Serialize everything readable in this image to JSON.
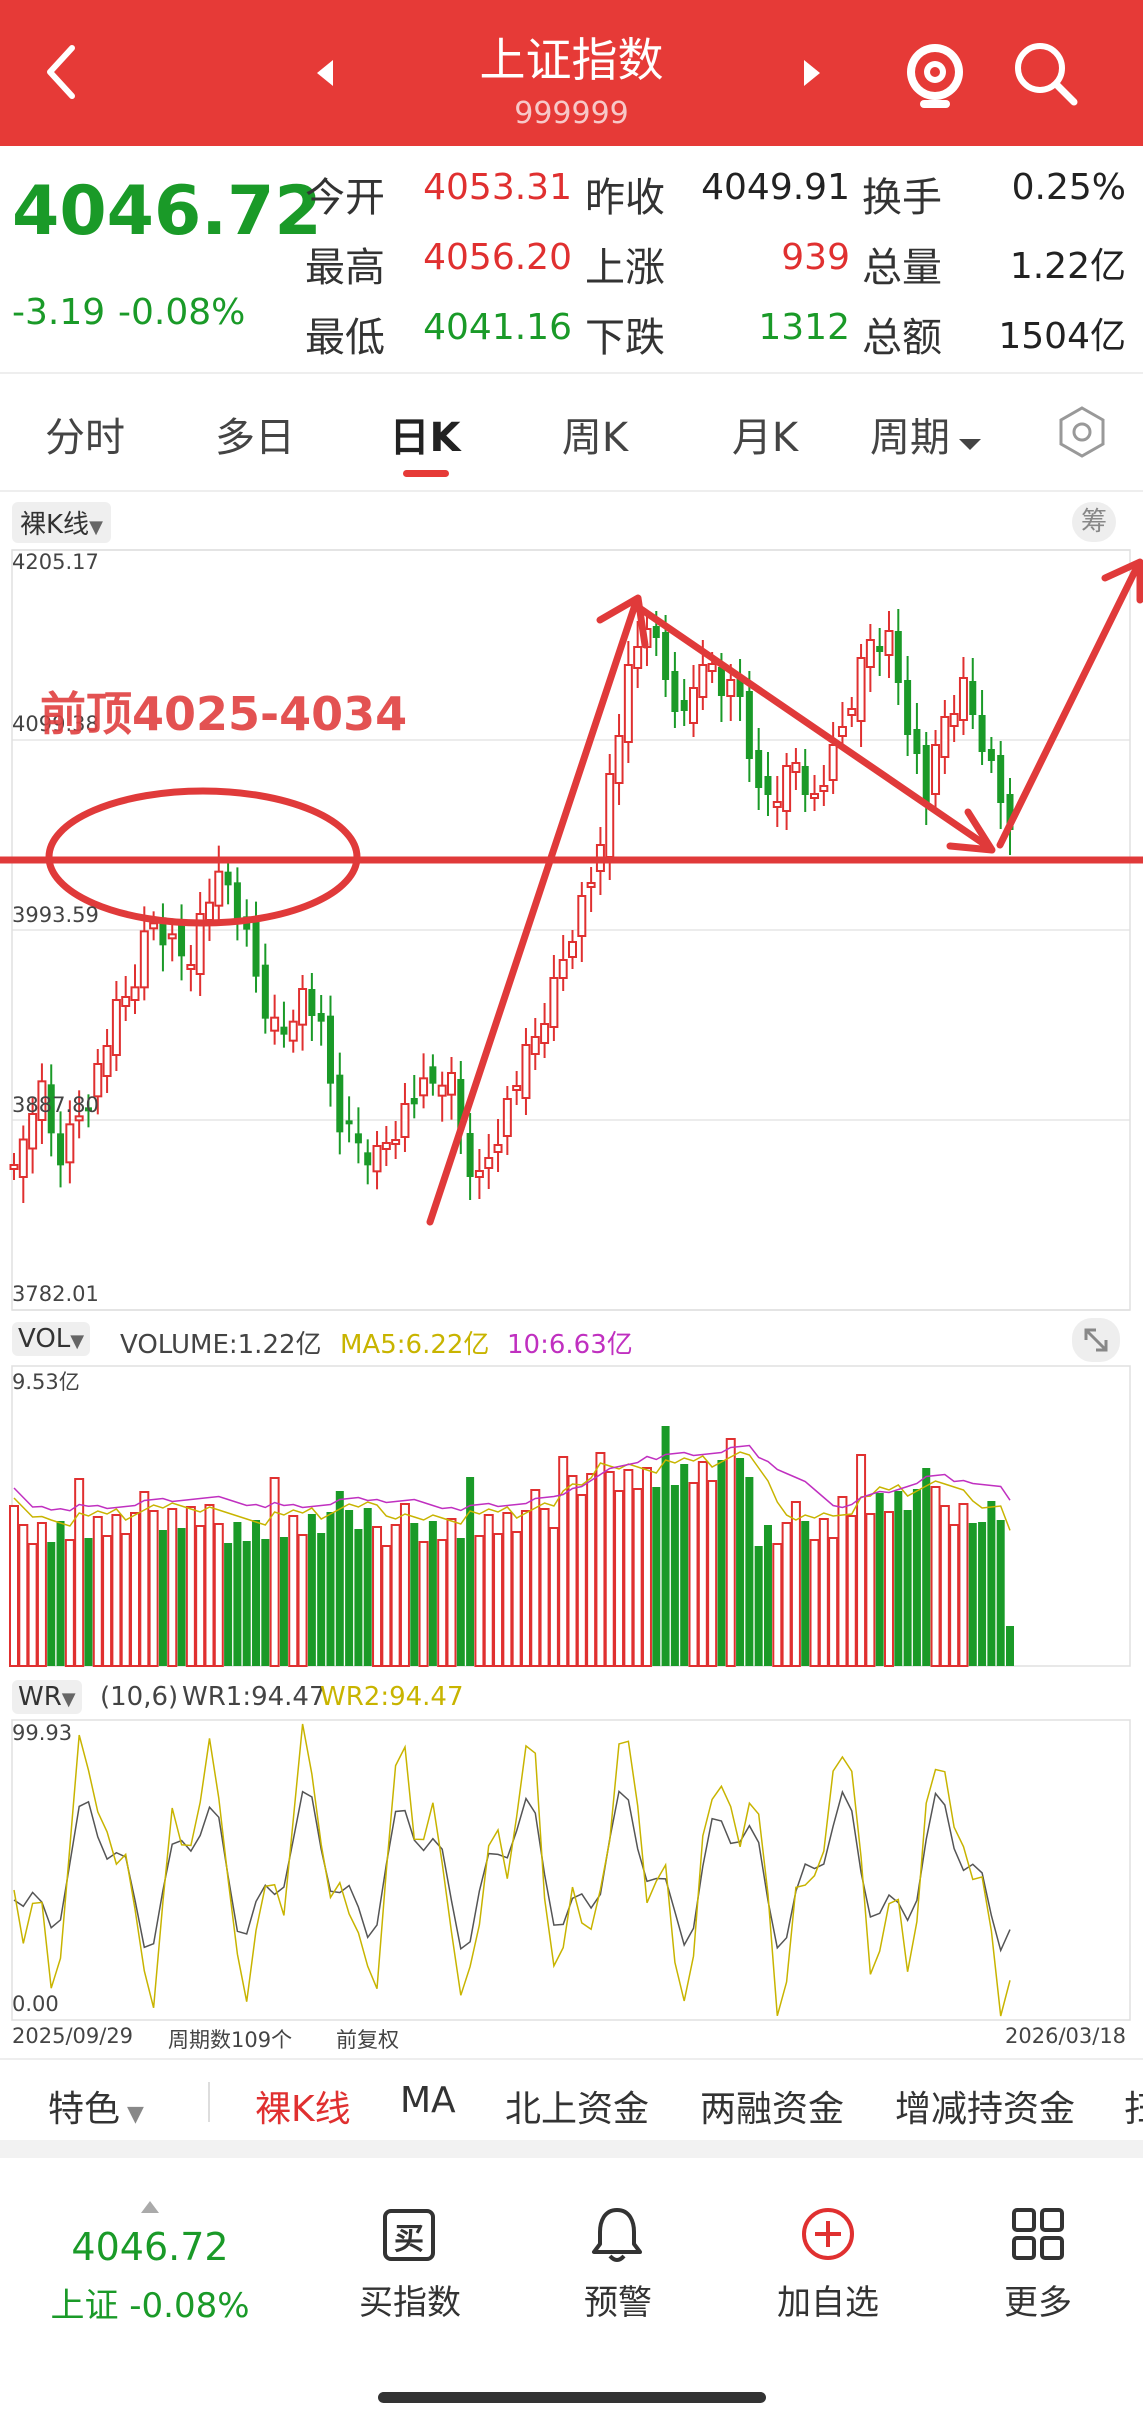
{
  "header": {
    "title": "上证指数",
    "code": "999999"
  },
  "quote": {
    "price": "4046.72",
    "change": "-3.19",
    "change_pct": "-0.08%",
    "open_label": "今开",
    "open": "4053.31",
    "high_label": "最高",
    "high": "4056.20",
    "low_label": "最低",
    "low": "4041.16",
    "prev_close_label": "昨收",
    "prev_close": "4049.91",
    "up_label": "上涨",
    "up": "939",
    "down_label": "下跌",
    "down": "1312",
    "turnover_label": "换手",
    "turnover": "0.25%",
    "volume_label": "总量",
    "volume": "1.22亿",
    "amount_label": "总额",
    "amount": "1504亿"
  },
  "tabs": [
    "分时",
    "多日",
    "日K",
    "周K",
    "月K",
    "周期"
  ],
  "active_tab": "日K",
  "kline": {
    "type_label": "裸K线",
    "chip_label": "筹",
    "price_high": "4205.17",
    "price_mid1": "4099.38",
    "price_mid2": "3993.59",
    "price_mid3": "3887.80",
    "price_low": "3782.01",
    "annotation": "前顶4025-4034"
  },
  "volume_panel": {
    "label": "VOL",
    "volume_text": "VOLUME:1.22亿",
    "ma5_text": "MA5:6.22亿",
    "ma10_text": "10:6.63亿",
    "max_label": "9.53亿"
  },
  "wr_panel": {
    "label": "WR",
    "params": "(10,6)",
    "wr1_text": "WR1:94.47",
    "wr2_text": "WR2:94.47",
    "max_label": "99.93",
    "min_label": "0.00"
  },
  "footer_axis": {
    "start_date": "2025/09/29",
    "period_count": "周期数109个",
    "adjust": "前复权",
    "end_date": "2026/03/18"
  },
  "indicator_tabs": [
    "特色",
    "裸K线",
    "MA",
    "北上资金",
    "两融资金",
    "增减持资金",
    "扫"
  ],
  "bottom_nav": {
    "price": "4046.72",
    "index_label": "上证 -0.08%",
    "buy_label": "买指数",
    "buy_icon_char": "买",
    "alert_label": "预警",
    "watch_label": "加自选",
    "more_label": "更多"
  },
  "colors": {
    "header_bg": "#e63a37",
    "up": "#e03030",
    "down": "#1a9a28",
    "ma5": "#c8b400",
    "ma10": "#c030c0"
  }
}
